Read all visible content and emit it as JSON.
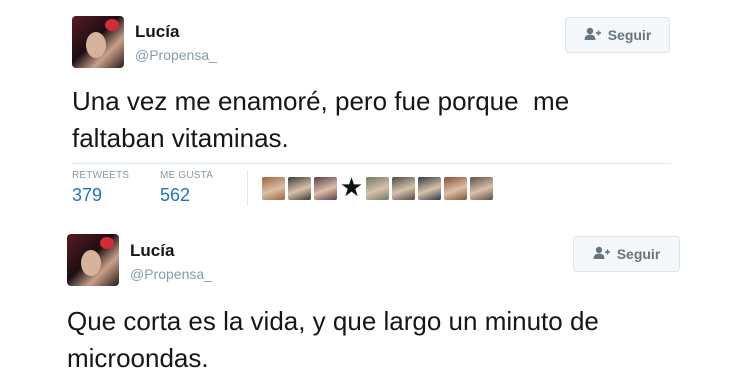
{
  "tweets": [
    {
      "user": {
        "name": "Lucía",
        "handle": "@Propensa_"
      },
      "follow_label": "Seguir",
      "text": "Una vez me enamoré, pero fue porque  me\nfaltaban vitaminas.",
      "stats": {
        "retweets_label": "RETWEETS",
        "retweets": "379",
        "likes_label": "ME GUSTA",
        "likes": "562"
      },
      "likers": [
        {
          "icon": "liker-avatar-icon",
          "color": "#a0643a"
        },
        {
          "icon": "liker-avatar-icon",
          "color": "#3b3b3b"
        },
        {
          "icon": "liker-avatar-icon",
          "color": "#5b3a4a"
        },
        {
          "icon": "star-icon",
          "color": "#111111"
        },
        {
          "icon": "liker-avatar-icon",
          "color": "#6d7a68"
        },
        {
          "icon": "liker-avatar-icon",
          "color": "#4a4a4a"
        },
        {
          "icon": "liker-avatar-icon",
          "color": "#2e3a44"
        },
        {
          "icon": "liker-avatar-icon",
          "color": "#8a5030"
        },
        {
          "icon": "liker-avatar-icon",
          "color": "#5a5048"
        }
      ]
    },
    {
      "user": {
        "name": "Lucía",
        "handle": "@Propensa_"
      },
      "follow_label": "Seguir",
      "text": "Que corta es la vida, y que largo un minuto de\nmicroondas."
    }
  ],
  "colors": {
    "link_blue": "#1b74c5",
    "muted_gray": "#8899a6",
    "text_dark": "#14171a"
  }
}
